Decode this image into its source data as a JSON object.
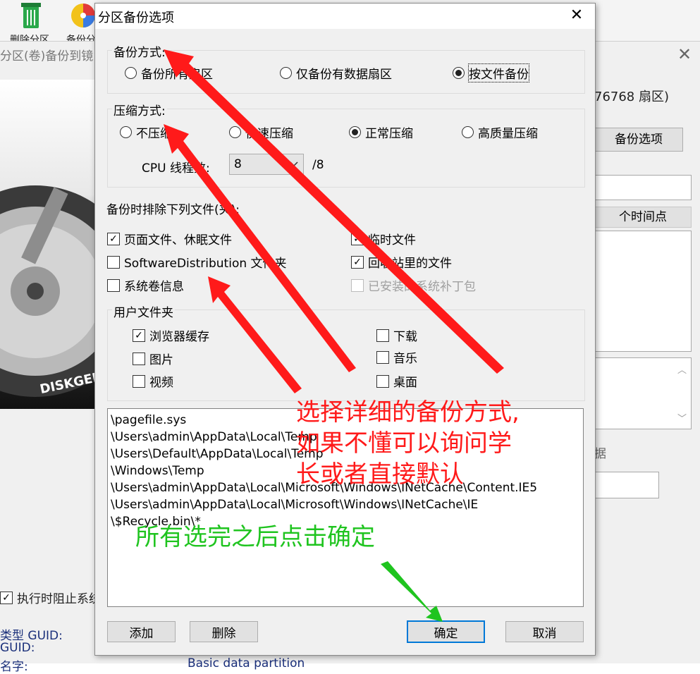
{
  "background": {
    "toolbar": {
      "delete_partition": "删除分区",
      "backup_partition": "备份分"
    },
    "window_title": "分区(卷)备份到镜",
    "sector_info": "76768 扇区)",
    "backup_options_button": "备份选项",
    "time_point_tab": "个时间点",
    "prevent_sleep_label": "执行时阻止系统",
    "partial_label": "据",
    "info_rows": [
      "类型 GUID:",
      "GUID:",
      "名字:"
    ],
    "partition_name": "Basic data partition"
  },
  "dialog": {
    "title": "分区备份选项",
    "backup_mode": {
      "label": "备份方式:",
      "options": [
        "备份所有扇区",
        "仅备份有数据扇区",
        "按文件备份"
      ],
      "selected": 2
    },
    "compression": {
      "label": "压缩方式:",
      "options": [
        "不压缩",
        "快速压缩",
        "正常压缩",
        "高质量压缩"
      ],
      "selected": 2,
      "cpu_label": "CPU 线程数:",
      "cpu_value": "8",
      "cpu_total": "/8"
    },
    "exclude": {
      "label": "备份时排除下列文件(夹):",
      "items": [
        {
          "label": "页面文件、休眠文件",
          "checked": true,
          "enabled": true
        },
        {
          "label": "临时文件",
          "checked": true,
          "enabled": true
        },
        {
          "label": "SoftwareDistribution 文件夹",
          "checked": false,
          "enabled": true
        },
        {
          "label": "回收站里的文件",
          "checked": true,
          "enabled": true
        },
        {
          "label": "系统卷信息",
          "checked": false,
          "enabled": true
        },
        {
          "label": "已安装的系统补丁包",
          "checked": false,
          "enabled": false
        }
      ]
    },
    "user_folders": {
      "label": "用户文件夹",
      "items": [
        {
          "label": "浏览器缓存",
          "checked": true
        },
        {
          "label": "下载",
          "checked": false
        },
        {
          "label": "图片",
          "checked": false
        },
        {
          "label": "音乐",
          "checked": false
        },
        {
          "label": "视频",
          "checked": false
        },
        {
          "label": "桌面",
          "checked": false
        }
      ]
    },
    "paths": [
      "\\pagefile.sys",
      "\\Users\\admin\\AppData\\Local\\Temp",
      "\\Users\\Default\\AppData\\Local\\Temp",
      "\\Windows\\Temp",
      "\\Users\\admin\\AppData\\Local\\Microsoft\\Windows\\INetCache\\Content.IE5",
      "\\Users\\admin\\AppData\\Local\\Microsoft\\Windows\\INetCache\\IE",
      "\\$Recycle.bin\\*"
    ],
    "buttons": {
      "add": "添加",
      "delete": "删除",
      "ok": "确定",
      "cancel": "取消"
    }
  },
  "annotations": {
    "red_lines": [
      "选择详细的备份方式,",
      "如果不懂可以询问学",
      "长或者直接默认"
    ],
    "green_text": "所有选完之后点击确定",
    "red_color": "#ff1a1a",
    "green_color": "#1fc41f"
  }
}
